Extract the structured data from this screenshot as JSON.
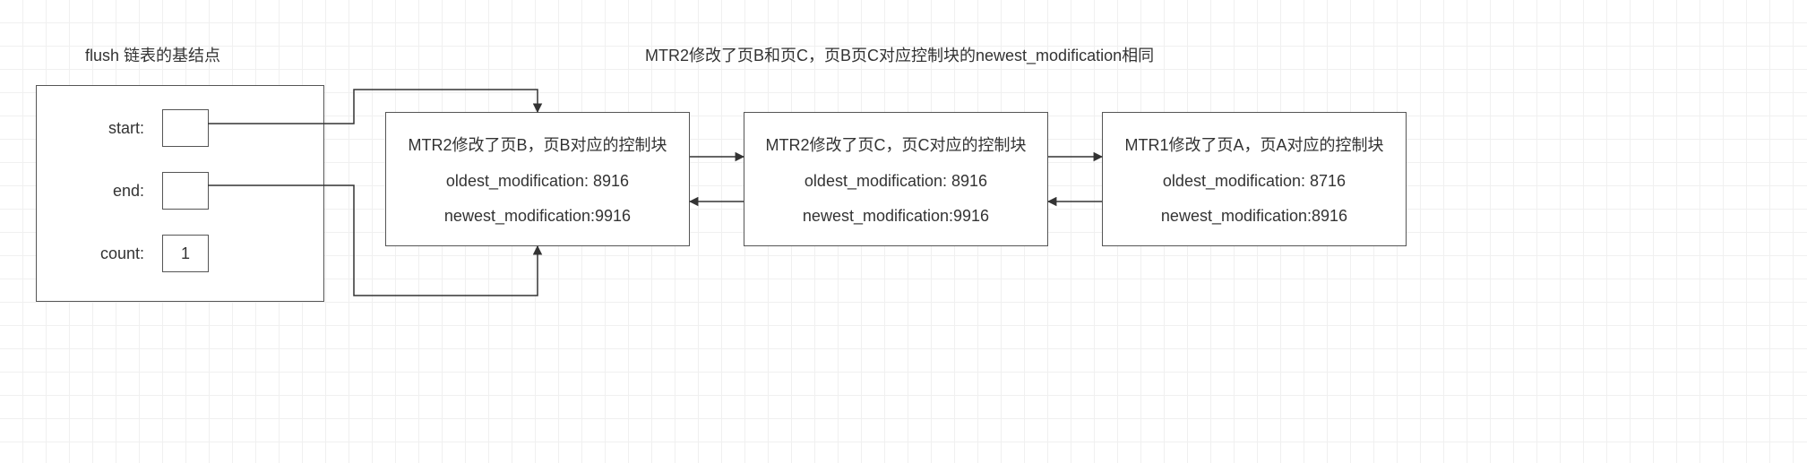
{
  "title_left": "flush 链表的基结点",
  "title_right": "MTR2修改了页B和页C，页B页C对应控制块的newest_modification相同",
  "base": {
    "start_label": "start:",
    "end_label": "end:",
    "count_label": "count:",
    "count_value": "1"
  },
  "nodes": [
    {
      "title": "MTR2修改了页B，页B对应的控制块",
      "oldest": "oldest_modification: 8916",
      "newest": "newest_modification:9916"
    },
    {
      "title": "MTR2修改了页C，页C对应的控制块",
      "oldest": "oldest_modification: 8916",
      "newest": "newest_modification:9916"
    },
    {
      "title": "MTR1修改了页A，页A对应的控制块",
      "oldest": "oldest_modification: 8716",
      "newest": "newest_modification:8916"
    }
  ]
}
